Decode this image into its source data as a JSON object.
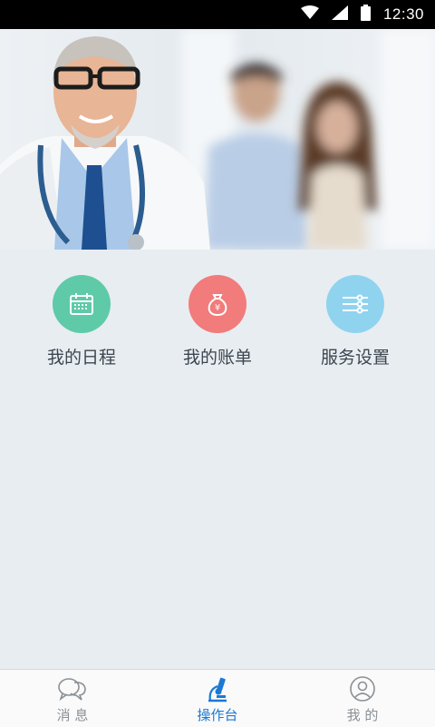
{
  "status_bar": {
    "time": "12:30"
  },
  "actions": [
    {
      "label": "我的日程",
      "icon": "calendar-icon",
      "color": "#5fcaa7"
    },
    {
      "label": "我的账单",
      "icon": "money-bag-icon",
      "color": "#f27b7b"
    },
    {
      "label": "服务设置",
      "icon": "sliders-icon",
      "color": "#8fd3ef"
    }
  ],
  "bottom_nav": {
    "items": [
      {
        "label": "消 息",
        "icon": "chat-bubbles-icon",
        "active": false
      },
      {
        "label": "操作台",
        "icon": "microscope-icon",
        "active": true
      },
      {
        "label": "我 的",
        "icon": "user-icon",
        "active": false
      }
    ]
  },
  "colors": {
    "accent": "#1a79d4",
    "inactive": "#8a9097",
    "background": "#e8edf1"
  }
}
